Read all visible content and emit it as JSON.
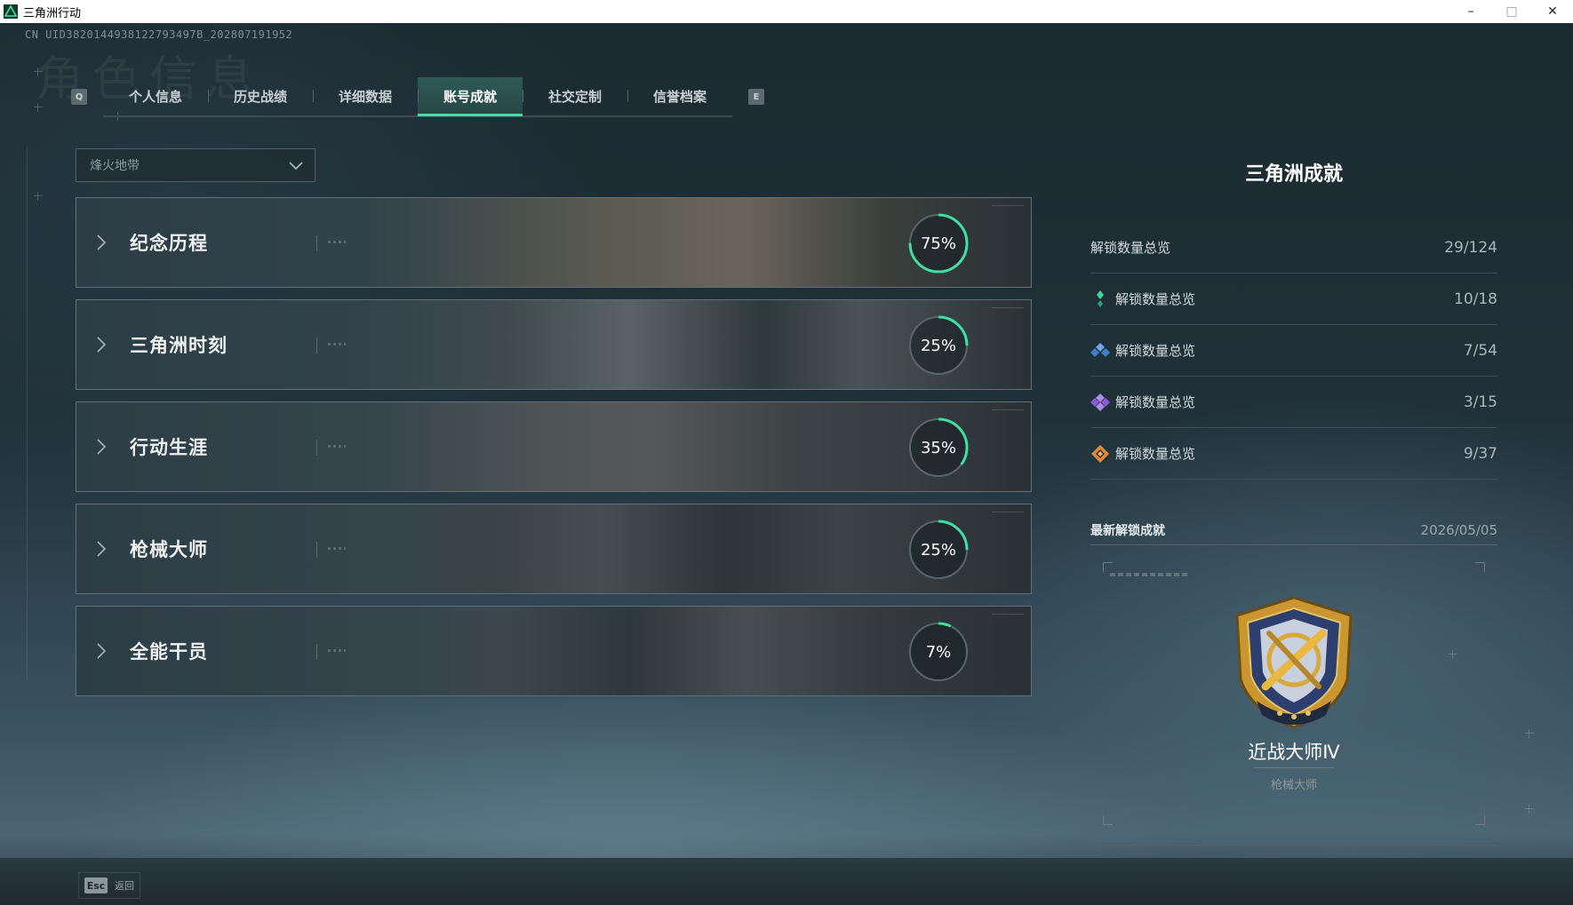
{
  "window": {
    "title": "三角洲行动",
    "minimize": "–",
    "maximize": "□",
    "close": "✕"
  },
  "uid": "CN UID3820144938122793497B_202807191952",
  "watermark": "角色信息",
  "tabs": {
    "left_key": "Q",
    "right_key": "E",
    "items": [
      {
        "label": "个人信息",
        "active": false
      },
      {
        "label": "历史战绩",
        "active": false
      },
      {
        "label": "详细数据",
        "active": false
      },
      {
        "label": "账号成就",
        "active": true
      },
      {
        "label": "社交定制",
        "active": false
      },
      {
        "label": "信誉档案",
        "active": false
      }
    ]
  },
  "mode_select": {
    "value": "烽火地带"
  },
  "categories": [
    {
      "name": "纪念历程",
      "percent_label": "75%",
      "progress": 0.75
    },
    {
      "name": "三角洲时刻",
      "percent_label": "25%",
      "progress": 0.25
    },
    {
      "name": "行动生涯",
      "percent_label": "35%",
      "progress": 0.35
    },
    {
      "name": "枪械大师",
      "percent_label": "25%",
      "progress": 0.25
    },
    {
      "name": "全能干员",
      "percent_label": "7%",
      "progress": 0.07
    }
  ],
  "summary": {
    "title": "三角洲成就",
    "rows": [
      {
        "label": "解锁数量总览",
        "value": "29/124",
        "icon": "",
        "color": ""
      },
      {
        "label": "解锁数量总览",
        "value": "10/18",
        "icon": "green-tier-icon",
        "color": "#3fd3a0"
      },
      {
        "label": "解锁数量总览",
        "value": "7/54",
        "icon": "blue-tier-icon",
        "color": "#4f8fd6"
      },
      {
        "label": "解锁数量总览",
        "value": "3/15",
        "icon": "purple-tier-icon",
        "color": "#9a6ad6"
      },
      {
        "label": "解锁数量总览",
        "value": "9/37",
        "icon": "gold-tier-icon",
        "color": "#e08a3a"
      }
    ]
  },
  "latest": {
    "label": "最新解锁成就",
    "date": "2026/05/05",
    "achievement_name": "近战大师Ⅳ",
    "achievement_category": "枪械大师"
  },
  "footer": {
    "esc_key": "Esc",
    "back_label": "返回"
  },
  "colors": {
    "accent": "#3fe0a3",
    "ring_track": "#59666c"
  }
}
